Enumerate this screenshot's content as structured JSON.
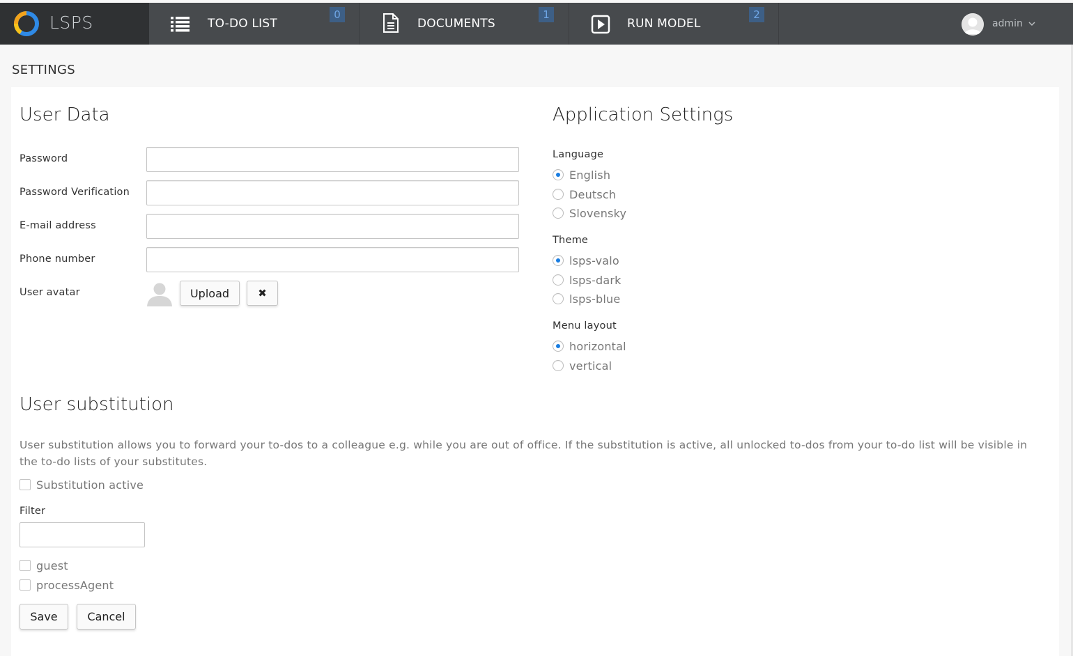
{
  "app": {
    "name": "LSPS"
  },
  "nav": {
    "items": [
      {
        "label": "TO-DO LIST",
        "badge": "0",
        "icon": "list-icon"
      },
      {
        "label": "DOCUMENTS",
        "badge": "1",
        "icon": "document-icon"
      },
      {
        "label": "RUN MODEL",
        "badge": "2",
        "icon": "play-icon"
      }
    ]
  },
  "user": {
    "name": "admin"
  },
  "page": {
    "title": "SETTINGS"
  },
  "user_data": {
    "title": "User Data",
    "password_label": "Password",
    "password_value": "",
    "password_verification_label": "Password Verification",
    "password_verification_value": "",
    "email_label": "E-mail address",
    "email_value": "",
    "phone_label": "Phone number",
    "phone_value": "",
    "avatar_label": "User avatar",
    "upload_label": "Upload",
    "remove_label": "✖"
  },
  "app_settings": {
    "title": "Application Settings",
    "language_label": "Language",
    "languages": [
      {
        "label": "English",
        "selected": true
      },
      {
        "label": "Deutsch",
        "selected": false
      },
      {
        "label": "Slovensky",
        "selected": false
      }
    ],
    "theme_label": "Theme",
    "themes": [
      {
        "label": "lsps-valo",
        "selected": true
      },
      {
        "label": "lsps-dark",
        "selected": false
      },
      {
        "label": "lsps-blue",
        "selected": false
      }
    ],
    "menu_layout_label": "Menu layout",
    "menu_layouts": [
      {
        "label": "horizontal",
        "selected": true
      },
      {
        "label": "vertical",
        "selected": false
      }
    ]
  },
  "substitution": {
    "title": "User substitution",
    "description": "User substitution allows you to forward your to-dos to a colleague e.g. while you are out of office. If the substitution is active, all unlocked to-dos from your to-do list will be visible in the to-do lists of your substitutes.",
    "active_label": "Substitution active",
    "active_checked": false,
    "filter_label": "Filter",
    "filter_value": "",
    "users": [
      {
        "label": "guest",
        "checked": false
      },
      {
        "label": "processAgent",
        "checked": false
      }
    ],
    "save_label": "Save",
    "cancel_label": "Cancel"
  },
  "colors": {
    "topbar": "#474a4d",
    "logo_bg": "#2f3133",
    "accent": "#197de1",
    "badge_bg": "#3d5f86",
    "badge_text": "#6fa6e6"
  }
}
